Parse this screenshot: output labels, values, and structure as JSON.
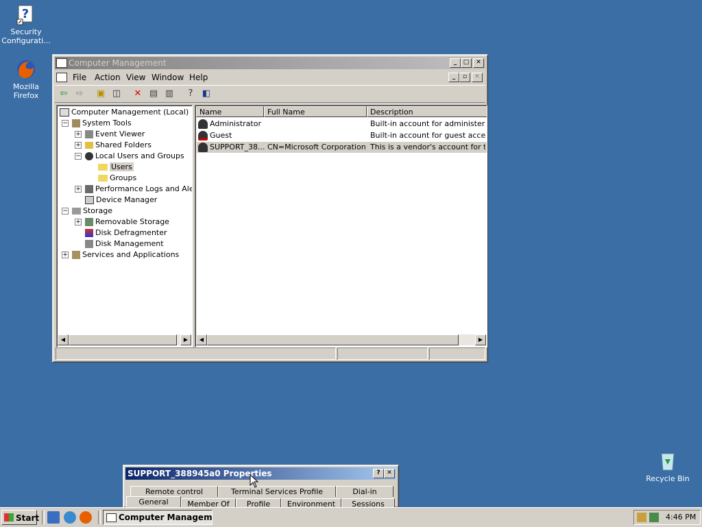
{
  "desktop": {
    "icons": [
      {
        "label": "Security Configurati...",
        "icon": "security-config-icon"
      },
      {
        "label": "Mozilla Firefox",
        "icon": "firefox-icon"
      },
      {
        "label": "Recycle Bin",
        "icon": "recycle-bin-icon"
      }
    ]
  },
  "mmc": {
    "title": "Computer Management",
    "menu": [
      "File",
      "Action",
      "View",
      "Window",
      "Help"
    ],
    "tree": [
      {
        "label": "Computer Management (Local)",
        "icon": "computer-icon"
      },
      {
        "label": "System Tools",
        "icon": "tools-icon"
      },
      {
        "label": "Event Viewer",
        "icon": "event-viewer-icon"
      },
      {
        "label": "Shared Folders",
        "icon": "shared-folder-icon"
      },
      {
        "label": "Local Users and Groups",
        "icon": "users-icon"
      },
      {
        "label": "Users",
        "icon": "folder-open-icon"
      },
      {
        "label": "Groups",
        "icon": "folder-icon"
      },
      {
        "label": "Performance Logs and Alerts",
        "icon": "performance-icon"
      },
      {
        "label": "Device Manager",
        "icon": "device-manager-icon"
      },
      {
        "label": "Storage",
        "icon": "storage-icon"
      },
      {
        "label": "Removable Storage",
        "icon": "removable-storage-icon"
      },
      {
        "label": "Disk Defragmenter",
        "icon": "defrag-icon"
      },
      {
        "label": "Disk Management",
        "icon": "disk-management-icon"
      },
      {
        "label": "Services and Applications",
        "icon": "services-icon"
      }
    ],
    "list": {
      "columns": [
        "Name",
        "Full Name",
        "Description"
      ],
      "rows": [
        {
          "name": "Administrator",
          "full_name": "",
          "description": "Built-in account for administering th"
        },
        {
          "name": "Guest",
          "full_name": "",
          "description": "Built-in account for guest access to"
        },
        {
          "name": "SUPPORT_38...",
          "full_name": "CN=Microsoft Corporation...",
          "description": "This is a vendor's account for the H"
        }
      ]
    }
  },
  "props": {
    "title": "SUPPORT_388945a0 Properties",
    "help_glyph": "?",
    "close_glyph": "✕",
    "tabs_back": [
      "Remote control",
      "Terminal Services Profile",
      "Dial-in"
    ],
    "tabs_front": [
      "General",
      "Member Of",
      "Profile",
      "Environment",
      "Sessions"
    ]
  },
  "taskbar": {
    "start_label": "Start",
    "task_label": "Computer Manageme...",
    "clock": "4:46 PM"
  }
}
